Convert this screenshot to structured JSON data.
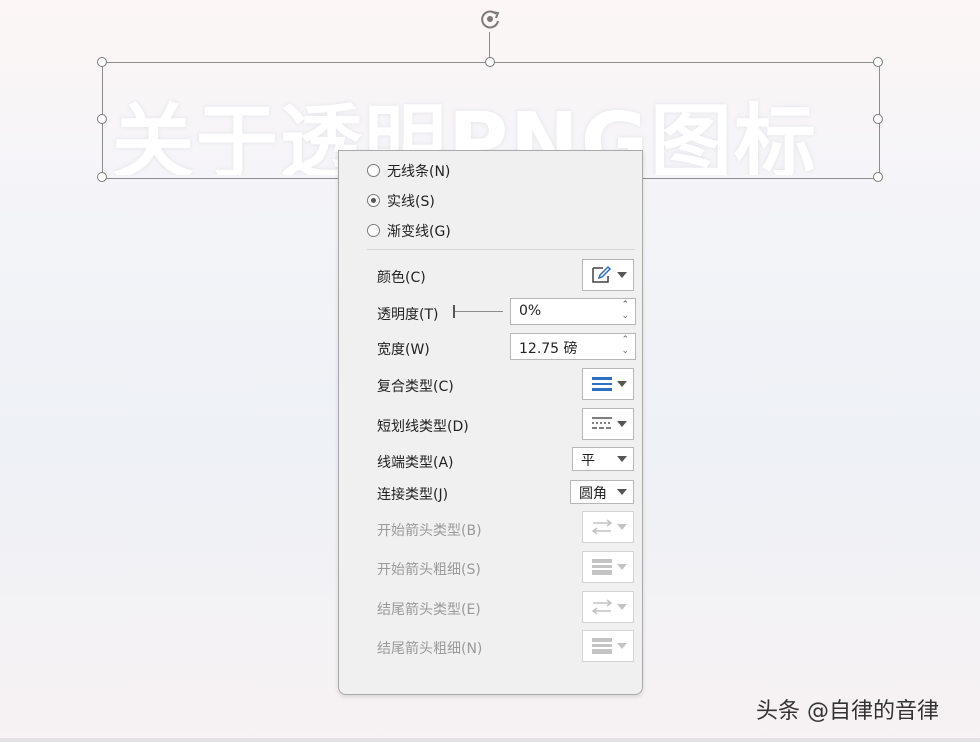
{
  "wordart": {
    "text": "关于透明PNG图标"
  },
  "line_options": {
    "radios": [
      {
        "label": "无线条(N)",
        "checked": false
      },
      {
        "label": "实线(S)",
        "checked": true
      },
      {
        "label": "渐变线(G)",
        "checked": false
      }
    ],
    "color": {
      "label": "颜色(C)"
    },
    "transparency": {
      "label": "透明度(T)",
      "value": "0%"
    },
    "width": {
      "label": "宽度(W)",
      "value": "12.75 磅"
    },
    "compound_type": {
      "label": "复合类型(C)"
    },
    "dash_type": {
      "label": "短划线类型(D)"
    },
    "cap_type": {
      "label": "线端类型(A)",
      "value": "平"
    },
    "join_type": {
      "label": "连接类型(J)",
      "value": "圆角"
    },
    "begin_arrow_type": {
      "label": "开始箭头类型(B)"
    },
    "begin_arrow_size": {
      "label": "开始箭头粗细(S)"
    },
    "end_arrow_type": {
      "label": "结尾箭头类型(E)"
    },
    "end_arrow_size": {
      "label": "结尾箭头粗细(N)"
    }
  },
  "watermark": "头条 @自律的音律",
  "colors": {
    "accent": "#2f6fbf",
    "panel_bg": "#f0f0f0"
  }
}
